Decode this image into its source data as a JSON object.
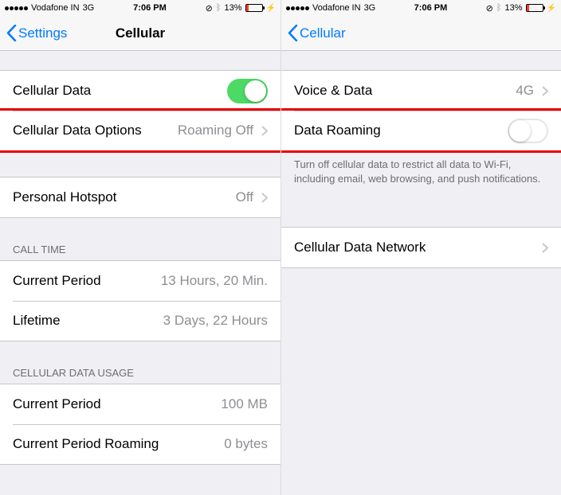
{
  "status_bar": {
    "carrier": "Vodafone IN",
    "network": "3G",
    "time": "7:06 PM",
    "battery_percent": "13%"
  },
  "left": {
    "nav_back": "Settings",
    "nav_title": "Cellular",
    "rows": {
      "cellular_data": "Cellular Data",
      "cellular_data_options": "Cellular Data Options",
      "cellular_data_options_value": "Roaming Off",
      "personal_hotspot": "Personal Hotspot",
      "personal_hotspot_value": "Off"
    },
    "call_time": {
      "header": "Call Time",
      "current_period": "Current Period",
      "current_period_value": "13 Hours, 20 Min.",
      "lifetime": "Lifetime",
      "lifetime_value": "3 Days, 22 Hours"
    },
    "data_usage": {
      "header": "Cellular Data Usage",
      "current_period": "Current Period",
      "current_period_value": "100 MB",
      "roaming": "Current Period Roaming",
      "roaming_value": "0 bytes"
    }
  },
  "right": {
    "nav_back": "Cellular",
    "rows": {
      "voice_data": "Voice & Data",
      "voice_data_value": "4G",
      "data_roaming": "Data Roaming"
    },
    "footer": "Turn off cellular data to restrict all data to Wi-Fi, including email, web browsing, and push notifications.",
    "cellular_network": "Cellular Data Network"
  }
}
